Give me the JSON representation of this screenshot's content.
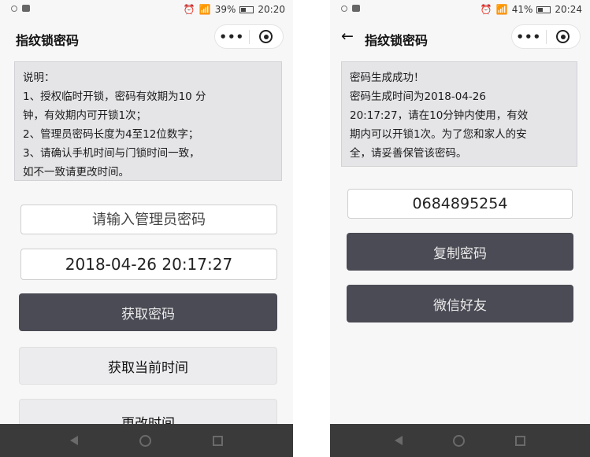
{
  "left": {
    "status": {
      "battery": "39%",
      "time": "20:20",
      "battery_level": 0.39
    },
    "title": "指纹锁密码",
    "note_lines": [
      "说明：",
      "1、授权临时开锁，密码有效期为10 分",
      "钟，有效期内可开锁1次；",
      "2、管理员密码长度为4至12位数字；",
      "3、请确认手机时间与门锁时间一致，",
      "如不一致请更改时间。"
    ],
    "password_placeholder": "请输入管理员密码",
    "datetime_value": "2018-04-26 20:17:27",
    "get_password_label": "获取密码",
    "get_time_label": "获取当前时间",
    "change_time_label": "更改时间"
  },
  "right": {
    "status": {
      "battery": "41%",
      "time": "20:24",
      "battery_level": 0.41
    },
    "title": "指纹锁密码",
    "note_lines": [
      "密码生成成功！",
      "密码生成时间为2018-04-26",
      "20:17:27，请在10分钟内使用，有效",
      "期内可以开锁1次。为了您和家人的安",
      "全，请妥善保管该密码。"
    ],
    "generated_password": "0684895254",
    "copy_label": "复制密码",
    "wechat_label": "微信好友"
  },
  "capsule": {
    "more_icon": "more-dots-icon",
    "close_icon": "target-icon"
  }
}
